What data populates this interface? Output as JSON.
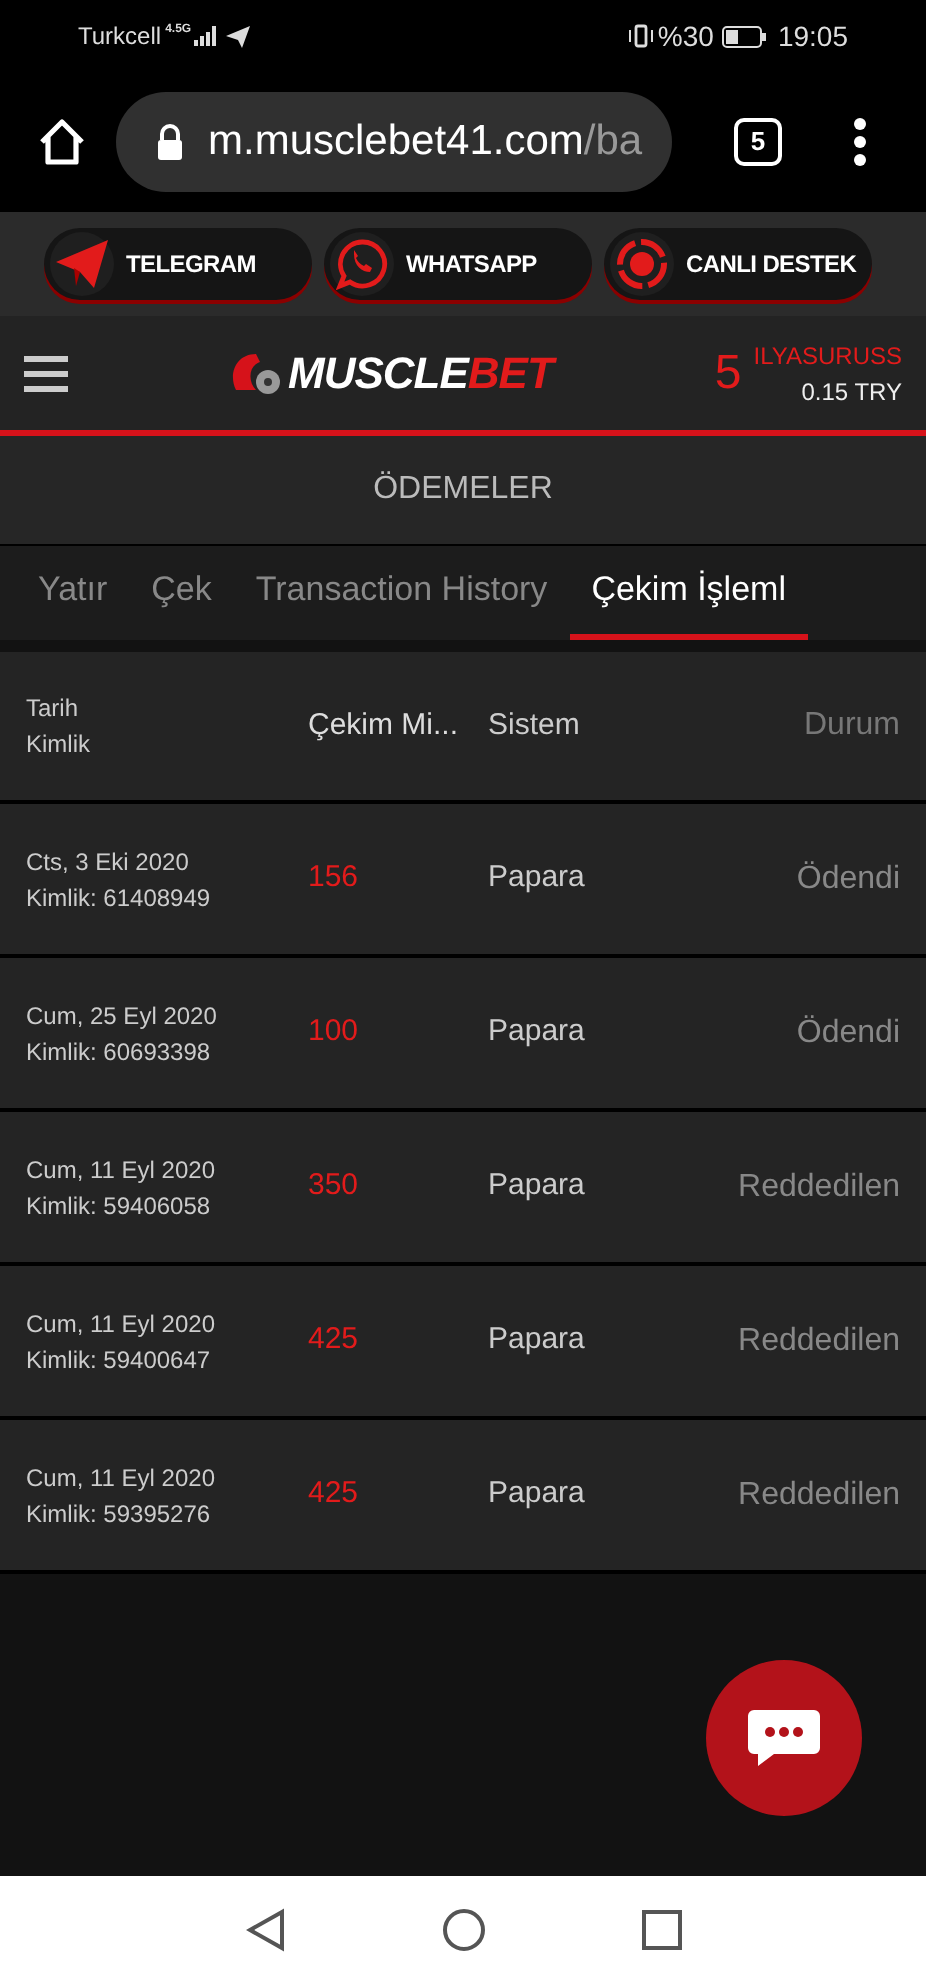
{
  "status_bar": {
    "carrier": "Turkcell",
    "network": "4.5G",
    "battery": "%30",
    "time": "19:05"
  },
  "browser": {
    "url_host": "m.musclebet41.com",
    "url_path": "/ba",
    "tab_count": "5"
  },
  "social_buttons": [
    {
      "kind": "telegram",
      "label": "TELEGRAM"
    },
    {
      "kind": "whatsapp",
      "label": "WHATSAPP"
    },
    {
      "kind": "support",
      "label": "CANLI DESTEK"
    }
  ],
  "header": {
    "logo_first": "MUSCLE",
    "logo_second": "BET",
    "badge": "5",
    "username": "ILYASURUSS",
    "balance": "0.15 TRY"
  },
  "page_title": "ÖDEMELER",
  "tabs": [
    {
      "label": "Yatır",
      "selected": false
    },
    {
      "label": "Çek",
      "selected": false
    },
    {
      "label": "Transaction History",
      "selected": false
    },
    {
      "label": "Çekim İşleml",
      "selected": true
    }
  ],
  "table": {
    "columns": {
      "date": "Tarih",
      "id": "Kimlik",
      "amount": "Çekim Mi...",
      "system": "Sistem",
      "status": "Durum"
    },
    "rows": [
      {
        "date": "Cts, 3 Eki 2020",
        "id": "Kimlik: 61408949",
        "amount": "156",
        "system": "Papara",
        "status": "Ödendi"
      },
      {
        "date": "Cum, 25 Eyl 2020",
        "id": "Kimlik: 60693398",
        "amount": "100",
        "system": "Papara",
        "status": "Ödendi"
      },
      {
        "date": "Cum, 11 Eyl 2020",
        "id": "Kimlik: 59406058",
        "amount": "350",
        "system": "Papara",
        "status": "Reddedilen"
      },
      {
        "date": "Cum, 11 Eyl 2020",
        "id": "Kimlik: 59400647",
        "amount": "425",
        "system": "Papara",
        "status": "Reddedilen"
      },
      {
        "date": "Cum, 11 Eyl 2020",
        "id": "Kimlik: 59395276",
        "amount": "425",
        "system": "Papara",
        "status": "Reddedilen"
      }
    ]
  }
}
